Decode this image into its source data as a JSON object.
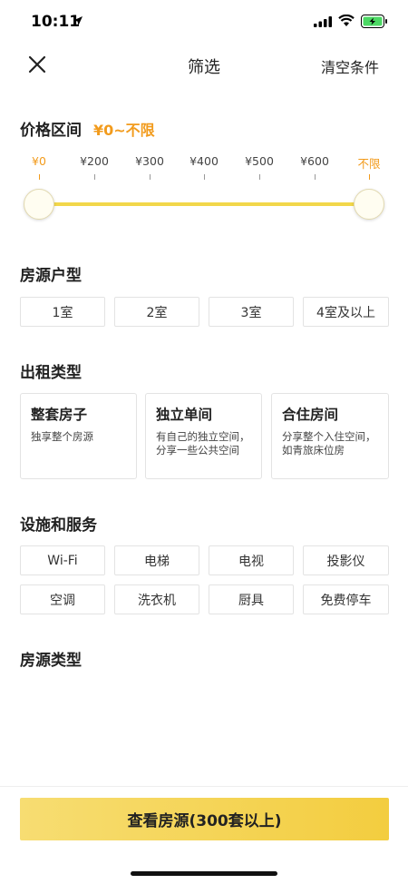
{
  "status_bar": {
    "time": "10:11",
    "icons": [
      "location-arrow-icon",
      "cellular-signal-icon",
      "wifi-icon",
      "battery-charging-icon"
    ]
  },
  "header": {
    "title": "筛选",
    "clear_label": "清空条件",
    "close_icon": "close-icon"
  },
  "price": {
    "title": "价格区间",
    "value": "¥0~不限",
    "ticks": [
      "¥0",
      "¥200",
      "¥300",
      "¥400",
      "¥500",
      "¥600",
      "不限"
    ],
    "range_low": "¥0",
    "range_high": "不限"
  },
  "room_type": {
    "title": "房源户型",
    "options": [
      "1室",
      "2室",
      "3室",
      "4室及以上"
    ]
  },
  "rental_type": {
    "title": "出租类型",
    "cards": [
      {
        "title": "整套房子",
        "desc": "独享整个房源"
      },
      {
        "title": "独立单间",
        "desc": "有自己的独立空间，分享一些公共空间"
      },
      {
        "title": "合住房间",
        "desc": "分享整个入住空间，如青旅床位房"
      }
    ]
  },
  "facilities": {
    "title": "设施和服务",
    "options": [
      "Wi-Fi",
      "电梯",
      "电视",
      "投影仪",
      "空调",
      "洗衣机",
      "厨具",
      "免费停车"
    ]
  },
  "property_type": {
    "title": "房源类型"
  },
  "cta": {
    "label": "查看房源(300套以上)"
  },
  "colors": {
    "accent": "#f29b1c",
    "slider_track": "#f2d74a",
    "cta_start": "#f7dd72",
    "cta_end": "#f3cd3f"
  }
}
